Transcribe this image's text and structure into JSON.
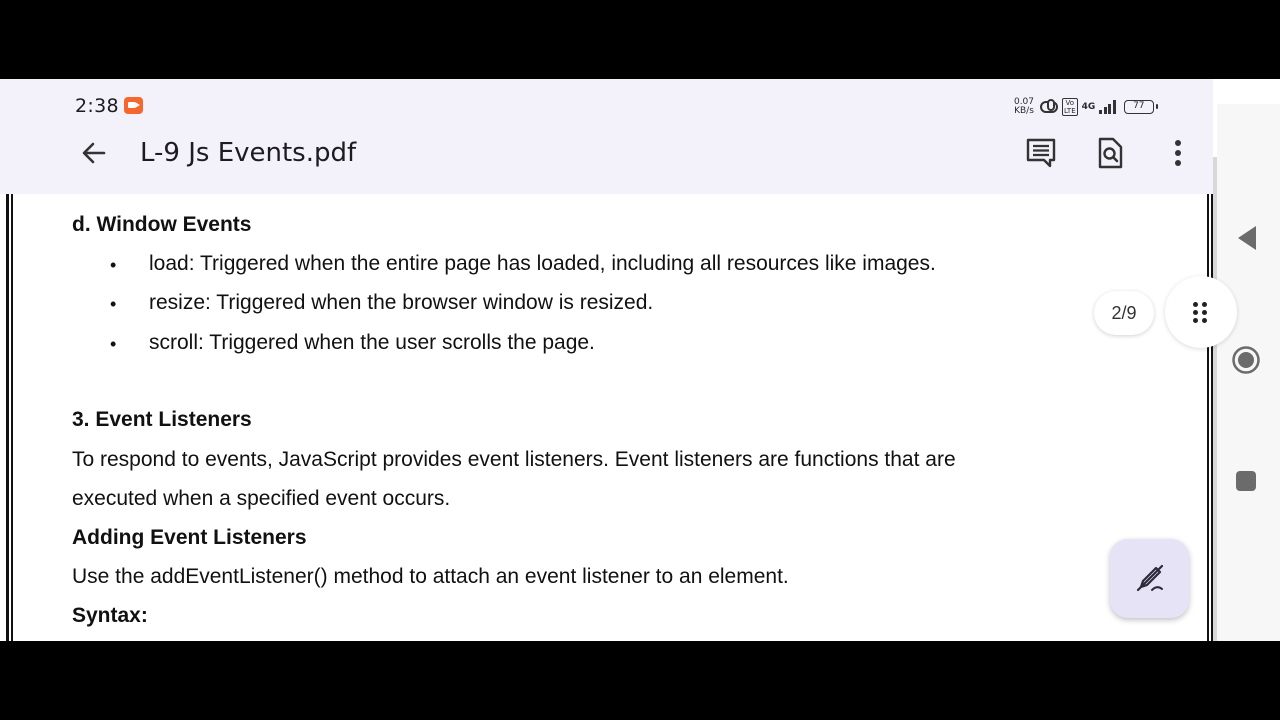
{
  "status_bar": {
    "time": "2:38",
    "net_speed_value": "0.07",
    "net_speed_unit": "KB/s",
    "volte_label_1": "Vo",
    "volte_label_2": "LTE",
    "network_type": "4G",
    "battery": "77"
  },
  "toolbar": {
    "title": "L-9 Js Events.pdf"
  },
  "document": {
    "section_d_heading": "d. Window Events",
    "bullets": [
      "load: Triggered when the entire page has loaded, including all resources like images.",
      "resize: Triggered when the browser window is resized.",
      "scroll: Triggered when the user scrolls the page."
    ],
    "bullet_symbol": "•",
    "section_3_heading": "3. Event Listeners",
    "paragraph_line_1": "To respond to events, JavaScript provides event listeners. Event listeners are functions that are",
    "paragraph_line_2": "executed when a specified event occurs.",
    "adding_heading": "Adding Event Listeners",
    "adding_text": "Use the addEventListener() method to attach an event listener to an element.",
    "syntax_heading": "Syntax:"
  },
  "page_indicator": "2/9",
  "icons": {
    "back": "arrow-left-icon",
    "comment": "comment-icon",
    "find": "find-in-page-icon",
    "more": "more-vert-icon",
    "grid": "drag-dots-icon",
    "edit": "edit-pen-icon"
  }
}
